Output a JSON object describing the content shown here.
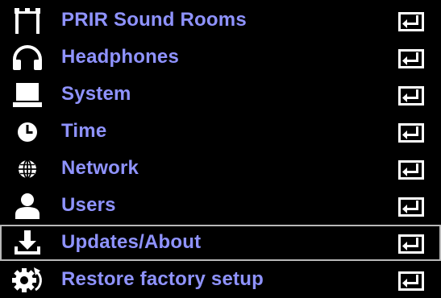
{
  "colors": {
    "background": "#000000",
    "label": "#8f93ff",
    "icon": "#ffffff",
    "selection_border": "#b8b8b8"
  },
  "menu": {
    "items": [
      {
        "label": "PRIR Sound Rooms",
        "icon": "sound-rooms-icon"
      },
      {
        "label": "Headphones",
        "icon": "headphones-icon"
      },
      {
        "label": "System",
        "icon": "laptop-icon"
      },
      {
        "label": "Time",
        "icon": "clock-icon"
      },
      {
        "label": "Network",
        "icon": "globe-icon"
      },
      {
        "label": "Users",
        "icon": "user-icon"
      },
      {
        "label": "Updates/About",
        "icon": "download-icon",
        "selected": true
      },
      {
        "label": "Restore factory setup",
        "icon": "gear-reset-icon"
      }
    ],
    "enter_icon": "enter-icon"
  }
}
